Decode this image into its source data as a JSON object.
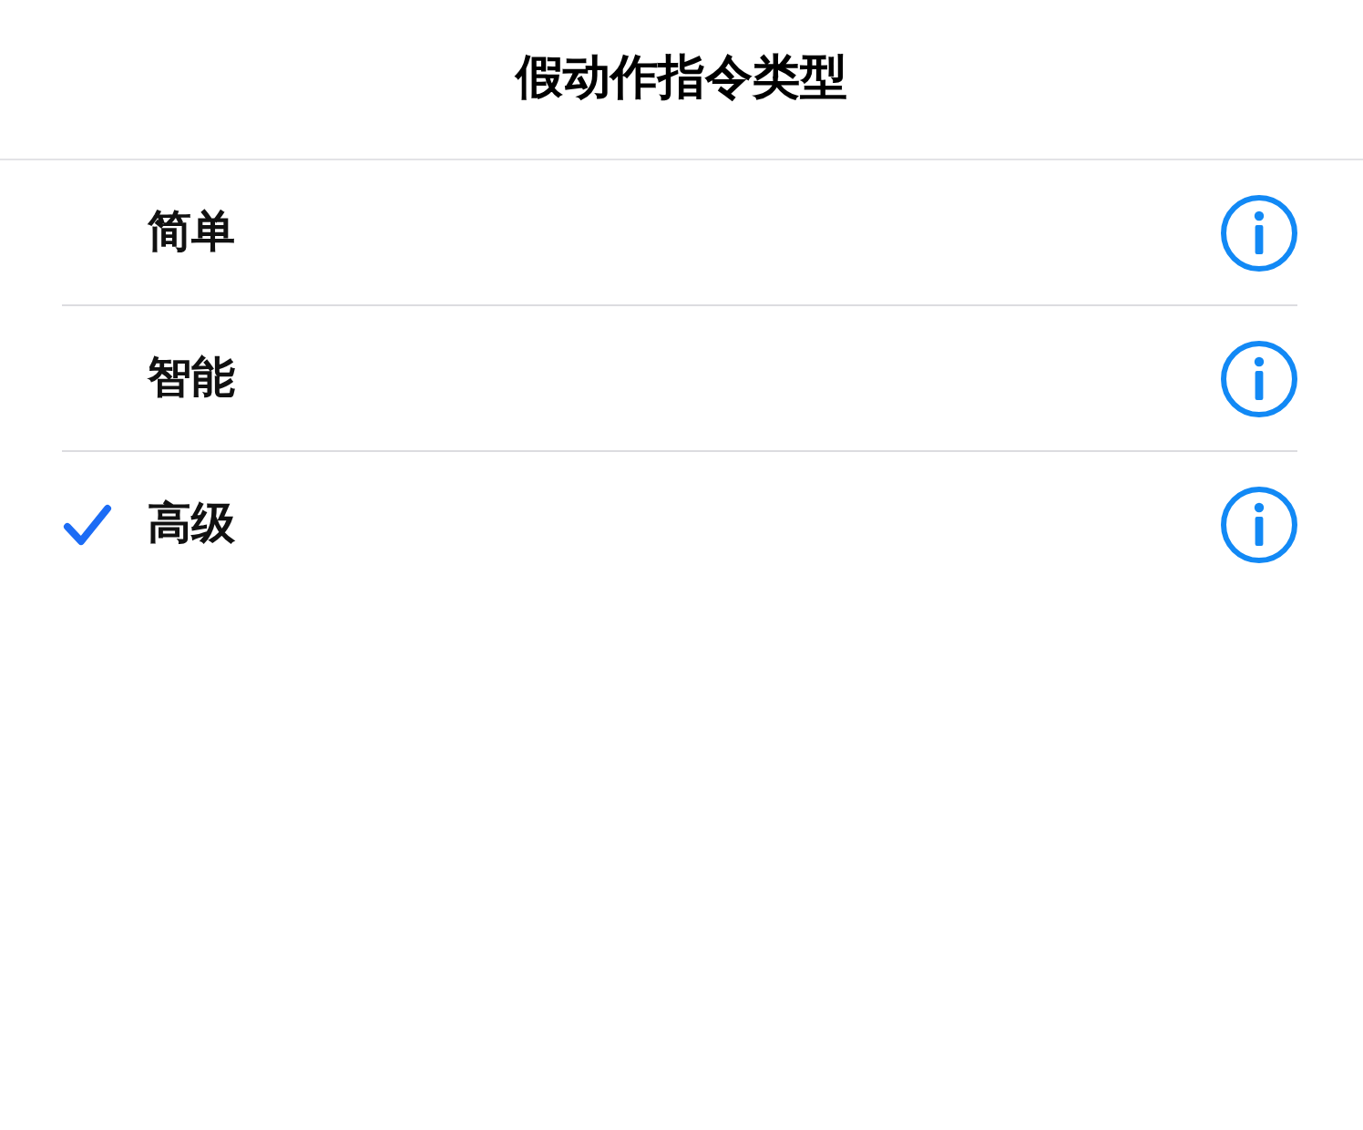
{
  "title": "假动作指令类型",
  "options": [
    {
      "label": "简单",
      "selected": false
    },
    {
      "label": "智能",
      "selected": false
    },
    {
      "label": "高级",
      "selected": true
    }
  ]
}
